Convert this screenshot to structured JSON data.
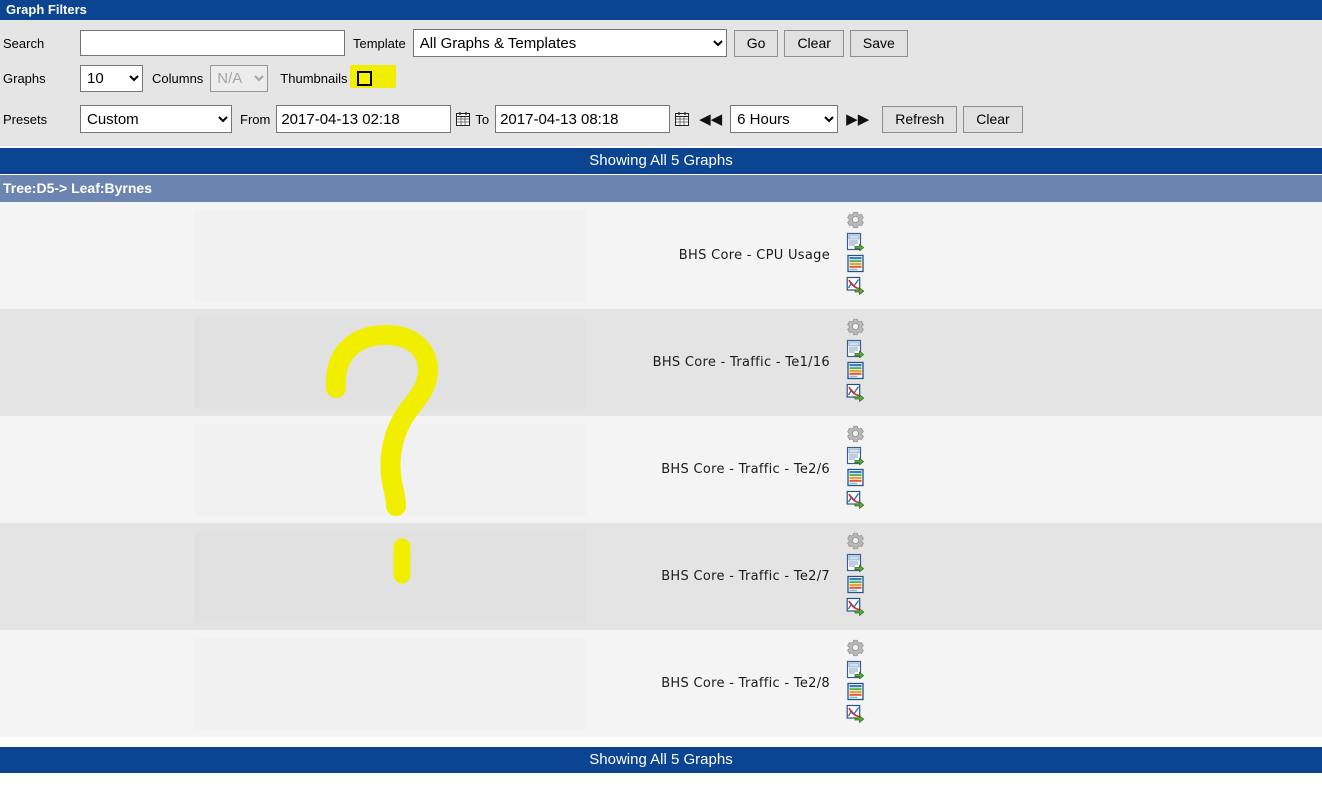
{
  "window": {
    "title": "Graph Filters"
  },
  "filters": {
    "search_label": "Search",
    "search_value": "",
    "search_placeholder": "",
    "template_label": "Template",
    "template_selected": "All Graphs & Templates",
    "template_options": [
      "All Graphs & Templates"
    ],
    "go_label": "Go",
    "clear_label": "Clear",
    "save_label": "Save",
    "graphs_label": "Graphs",
    "graphs_selected": "10",
    "graphs_options": [
      "10"
    ],
    "columns_label": "Columns",
    "columns_selected": "N/A",
    "columns_options": [
      "N/A"
    ],
    "thumbnails_label": "Thumbnails",
    "thumbnails_checked": false,
    "presets_label": "Presets",
    "presets_selected": "Custom",
    "presets_options": [
      "Custom"
    ],
    "from_label": "From",
    "from_value": "2017-04-13 02:18",
    "to_label": "To",
    "to_value": "2017-04-13 08:18",
    "timespan_selected": "6 Hours",
    "timespan_options": [
      "6 Hours"
    ],
    "shift_left_icon": "double-left-arrow-icon",
    "shift_right_icon": "double-right-arrow-icon",
    "calendar_icon": "calendar-icon",
    "refresh_label": "Refresh",
    "clear2_label": "Clear"
  },
  "status": {
    "showing_top": "Showing All 5 Graphs",
    "showing_bottom": "Showing All 5 Graphs"
  },
  "tree": {
    "header": "Tree:D5-> Leaf:Byrnes"
  },
  "graphs": [
    {
      "title": "BHS Core - CPU Usage"
    },
    {
      "title": "BHS Core - Traffic - Te1/16"
    },
    {
      "title": "BHS Core - Traffic - Te2/6"
    },
    {
      "title": "BHS Core - Traffic - Te2/7"
    },
    {
      "title": "BHS Core - Traffic - Te2/8"
    }
  ],
  "row_icons": [
    "gear-icon",
    "page-export-icon",
    "report-list-icon",
    "graph-export-icon"
  ],
  "annotations": {
    "question_mark": "yellow-question-mark-marker",
    "question_dot": "yellow-question-mark-dot-marker",
    "thumbnails_highlight": "yellow-highlight-marker"
  },
  "colors": {
    "header_blue": "#0b4491",
    "tree_blue": "#6b85b0",
    "panel_gray": "#e5e5e5",
    "row_odd": "#f4f4f4",
    "row_even": "#e4e4e4",
    "marker_yellow": "#f2ee00"
  }
}
